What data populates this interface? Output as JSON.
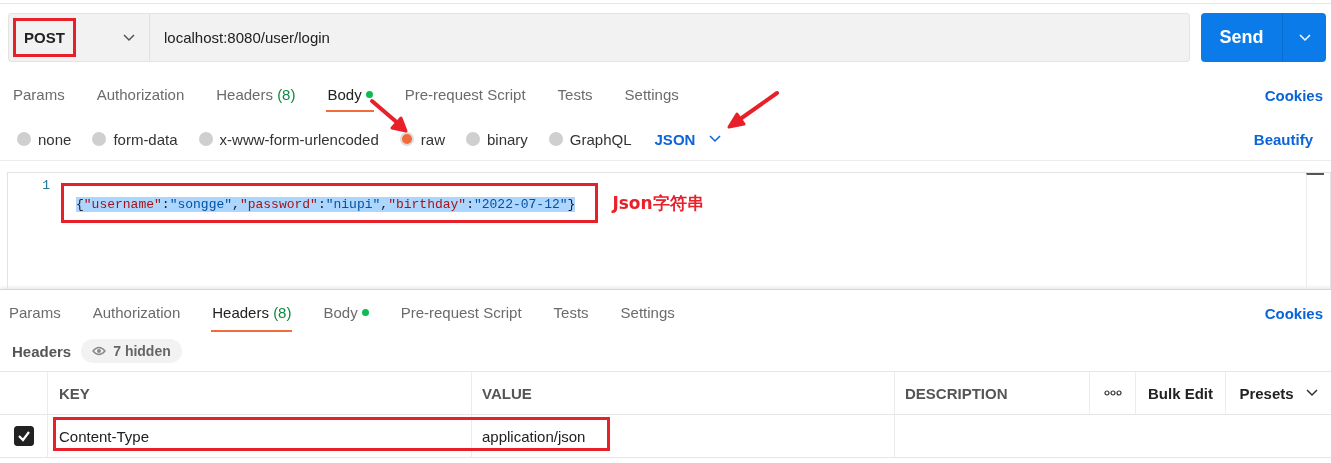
{
  "request": {
    "method": "POST",
    "method_highlighted": true,
    "url": "localhost:8080/user/login",
    "send": "Send"
  },
  "request_tabs": [
    {
      "label": "Params",
      "selected": false
    },
    {
      "label": "Authorization",
      "selected": false
    },
    {
      "label": "Headers",
      "count": "(8)",
      "selected": false
    },
    {
      "label": "Body",
      "dot": true,
      "selected": true
    },
    {
      "label": "Pre-request Script",
      "selected": false
    },
    {
      "label": "Tests",
      "selected": false
    },
    {
      "label": "Settings",
      "selected": false
    }
  ],
  "cookies": "Cookies",
  "body_types": [
    {
      "label": "none",
      "selected": false
    },
    {
      "label": "form-data",
      "selected": false
    },
    {
      "label": "x-www-form-urlencoded",
      "selected": false
    },
    {
      "label": "raw",
      "selected": true
    },
    {
      "label": "binary",
      "selected": false
    },
    {
      "label": "GraphQL",
      "selected": false
    }
  ],
  "format": "JSON",
  "beautify": "Beautify",
  "editor": {
    "lines": [
      {
        "number": "1",
        "selected": true,
        "highlighted": true,
        "tokens": [
          {
            "kind": "punct",
            "text": "{"
          },
          {
            "kind": "key",
            "text": "\"username\""
          },
          {
            "kind": "punct",
            "text": ":"
          },
          {
            "kind": "string",
            "text": "\"songge\""
          },
          {
            "kind": "punct",
            "text": ","
          },
          {
            "kind": "key",
            "text": "\"password\""
          },
          {
            "kind": "punct",
            "text": ":"
          },
          {
            "kind": "string",
            "text": "\"niupi\""
          },
          {
            "kind": "punct",
            "text": ","
          },
          {
            "kind": "key",
            "text": "\"birthday\""
          },
          {
            "kind": "punct",
            "text": ":"
          },
          {
            "kind": "string",
            "text": "\"2022-07-12\""
          },
          {
            "kind": "punct",
            "text": "}"
          }
        ]
      }
    ]
  },
  "annotation_note": "Json字符串",
  "response_tabs": [
    {
      "label": "Params",
      "selected": false
    },
    {
      "label": "Authorization",
      "selected": false
    },
    {
      "label": "Headers",
      "count": "(8)",
      "selected": true
    },
    {
      "label": "Body",
      "dot": true,
      "selected": false
    },
    {
      "label": "Pre-request Script",
      "selected": false
    },
    {
      "label": "Tests",
      "selected": false
    },
    {
      "label": "Settings",
      "selected": false
    }
  ],
  "response_cookies": "Cookies",
  "headers_label": "Headers",
  "hidden_badge": "7 hidden",
  "table": {
    "columns": [
      "KEY",
      "VALUE",
      "DESCRIPTION"
    ],
    "bulk_edit": "Bulk Edit",
    "presets": "Presets",
    "rows": [
      {
        "checked": true,
        "highlighted": true,
        "key": "Content-Type",
        "value": "application/json"
      }
    ]
  }
}
